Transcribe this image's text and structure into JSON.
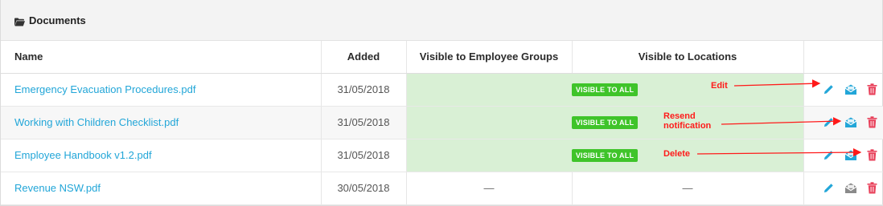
{
  "panel": {
    "title": "Documents",
    "icon": "folder-open-icon"
  },
  "table": {
    "headers": [
      "Name",
      "Added",
      "Visible to Employee Groups",
      "Visible to Locations",
      ""
    ],
    "rows": [
      {
        "name": "Emergency Evacuation Procedures.pdf",
        "added": "31/05/2018",
        "visible": "VISIBLE TO ALL"
      },
      {
        "name": "Working with Children Checklist.pdf",
        "added": "31/05/2018",
        "visible": "VISIBLE TO ALL"
      },
      {
        "name": "Employee Handbook v1.2.pdf",
        "added": "31/05/2018",
        "visible": "VISIBLE TO ALL"
      },
      {
        "name": "Revenue NSW.pdf",
        "added": "30/05/2018",
        "groups": "—",
        "locations": "—"
      }
    ],
    "actions": [
      "edit-pencil-icon",
      "resend-notification-icon",
      "delete-trash-icon"
    ]
  },
  "annotations": {
    "edit": "Edit",
    "resend_line1": "Resend",
    "resend_line2": "notification",
    "delete": "Delete"
  },
  "colors": {
    "link": "#22a6d8",
    "visible_bg": "#d9f0d5",
    "badge": "#3fc42a",
    "delete_icon": "#e8405a",
    "mail_icon": "#22a6d8",
    "mail_icon_inactive": "#8a8a8a",
    "annotation": "#ff1a1a"
  }
}
